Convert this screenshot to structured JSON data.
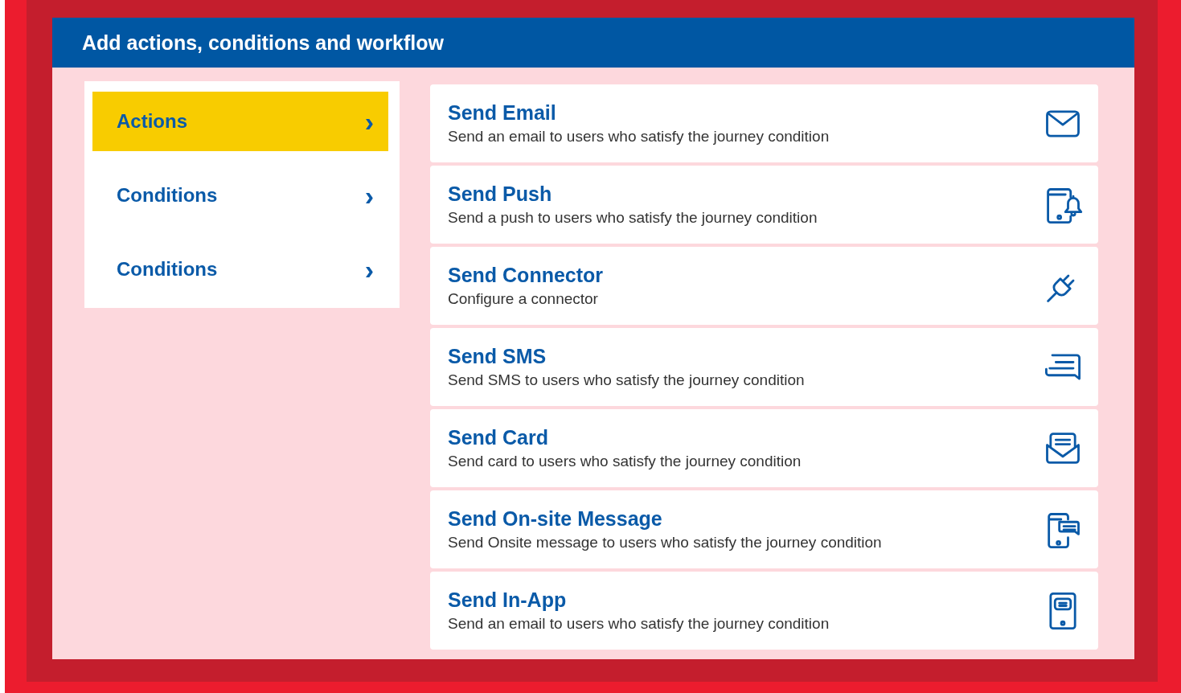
{
  "panel": {
    "title": "Add actions, conditions and workflow"
  },
  "menu": [
    {
      "label": "Actions",
      "selected": true,
      "arrow": "›"
    },
    {
      "label": "Conditions",
      "selected": false,
      "arrow": "›"
    },
    {
      "label": "Conditions",
      "selected": false,
      "arrow": "›"
    }
  ],
  "actions": [
    {
      "title": "Send Email",
      "description": "Send an email to users who satisfy the journey condition"
    },
    {
      "title": "Send Push",
      "description": "Send a push to users who satisfy the journey condition"
    },
    {
      "title": "Send Connector",
      "description": "Configure a connector"
    },
    {
      "title": "Send SMS",
      "description": "Send SMS to users who satisfy the journey condition"
    },
    {
      "title": "Send Card",
      "description": "Send card to users who satisfy the journey condition"
    },
    {
      "title": "Send On-site Message",
      "description": "Send Onsite message to users who satisfy the journey condition"
    },
    {
      "title": "Send In-App",
      "description": "Send an email to users who satisfy the journey condition"
    }
  ]
}
